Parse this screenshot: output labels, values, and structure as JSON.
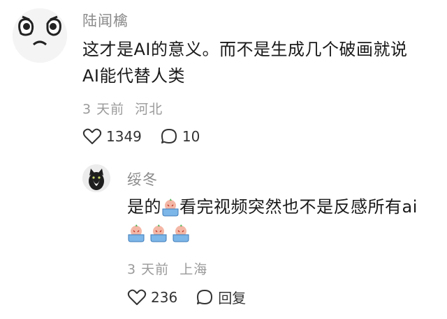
{
  "comment": {
    "username": "陆闻檎",
    "line1": "这才是AI的意义。而不是生成几个破画就说",
    "line2": "AI能代替人类",
    "time": "3 天前",
    "location": "河北",
    "likes": "1349",
    "replies": "10"
  },
  "reply": {
    "username": "绥冬",
    "text_before": "是的",
    "text_after": "看完视频突然也不是反感所有ai",
    "time": "3 天前",
    "location": "上海",
    "likes": "236",
    "reply_label": "回复"
  },
  "colors": {
    "text_primary": "#1a1a1a",
    "text_secondary": "#9a9a9a",
    "emoji_face": "#f4b7a6",
    "emoji_tub": "#7db6e8"
  },
  "icons": [
    "heart-icon",
    "comment-icon"
  ]
}
